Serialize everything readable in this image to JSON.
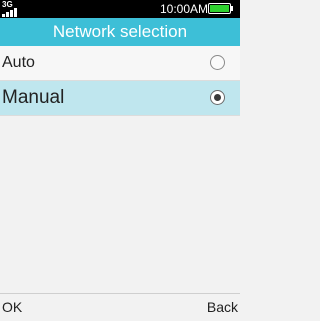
{
  "status": {
    "network_type": "3G",
    "time": "10:00AM",
    "battery_color": "#2fd12f",
    "signal_icon": "signal-bars-icon",
    "battery_icon": "battery-icon"
  },
  "title": "Network selection",
  "options": [
    {
      "label": "Auto",
      "selected": false
    },
    {
      "label": "Manual",
      "selected": true
    }
  ],
  "softkeys": {
    "left": "OK",
    "right": "Back"
  },
  "colors": {
    "title_bar": "#3dbfd7",
    "selected_row": "#bfe6ee"
  }
}
